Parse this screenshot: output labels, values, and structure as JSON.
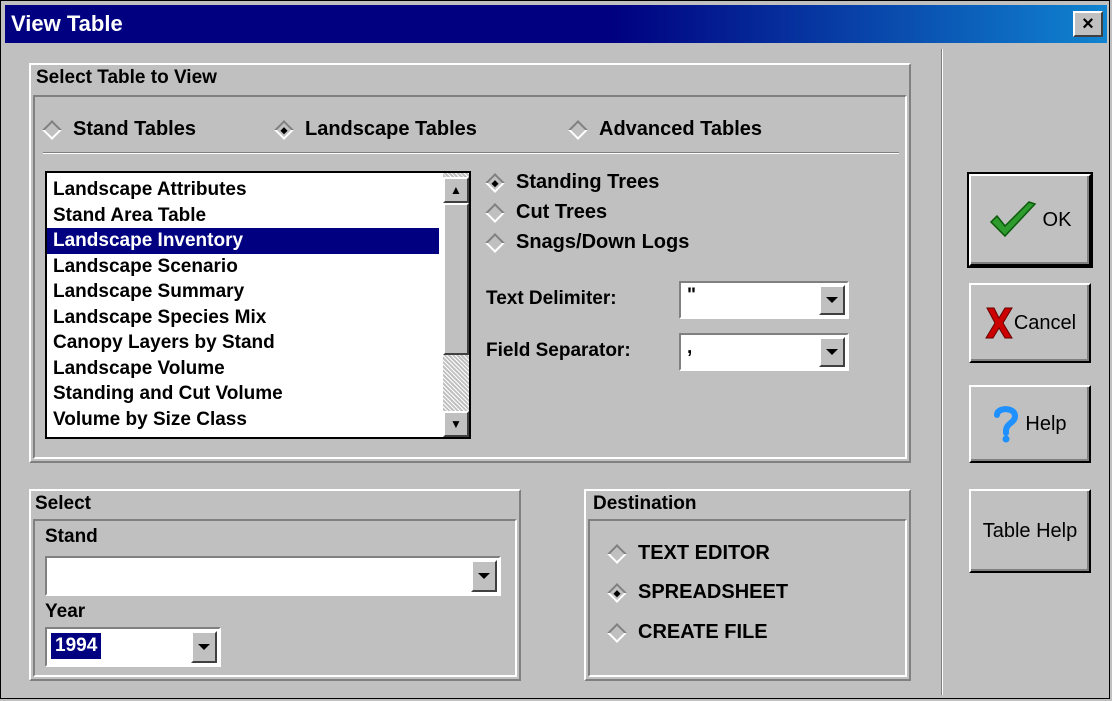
{
  "window": {
    "title": "View Table",
    "close_label": "×"
  },
  "select_table": {
    "title": "Select Table to View",
    "categories": [
      {
        "label": "Stand Tables",
        "selected": false
      },
      {
        "label": "Landscape Tables",
        "selected": true
      },
      {
        "label": "Advanced Tables",
        "selected": false
      }
    ],
    "tables": [
      {
        "label": "Landscape Attributes",
        "selected": false
      },
      {
        "label": "Stand Area Table",
        "selected": false
      },
      {
        "label": "Landscape Inventory",
        "selected": true
      },
      {
        "label": "Landscape Scenario",
        "selected": false
      },
      {
        "label": "Landscape Summary",
        "selected": false
      },
      {
        "label": "Landscape Species Mix",
        "selected": false
      },
      {
        "label": "Canopy Layers by Stand",
        "selected": false
      },
      {
        "label": "Landscape Volume",
        "selected": false
      },
      {
        "label": "Standing and Cut Volume",
        "selected": false
      },
      {
        "label": "Volume by Size Class",
        "selected": false
      }
    ],
    "tree_types": [
      {
        "label": "Standing Trees",
        "selected": true
      },
      {
        "label": "Cut Trees",
        "selected": false
      },
      {
        "label": "Snags/Down Logs",
        "selected": false
      }
    ],
    "text_delimiter": {
      "label": "Text Delimiter:",
      "value": "\""
    },
    "field_separator": {
      "label": "Field Separator:",
      "value": ","
    }
  },
  "select": {
    "title": "Select",
    "stand_label": "Stand",
    "stand_value": "",
    "year_label": "Year",
    "year_value": "1994"
  },
  "destination": {
    "title": "Destination",
    "options": [
      {
        "label": "TEXT EDITOR",
        "selected": false
      },
      {
        "label": "SPREADSHEET",
        "selected": true
      },
      {
        "label": "CREATE FILE",
        "selected": false
      }
    ]
  },
  "buttons": {
    "ok": "OK",
    "cancel": "Cancel",
    "help": "Help",
    "table_help": "Table Help"
  },
  "icons": {
    "ok": "checkmark-icon",
    "cancel": "x-mark-icon",
    "help": "question-mark-icon"
  },
  "colors": {
    "title_bar": "#000080",
    "selection": "#000080",
    "face": "#c0c0c0",
    "ok_check": "#2e9b2e",
    "cancel_x": "#cc0000",
    "help_mark": "#1e90ff"
  }
}
